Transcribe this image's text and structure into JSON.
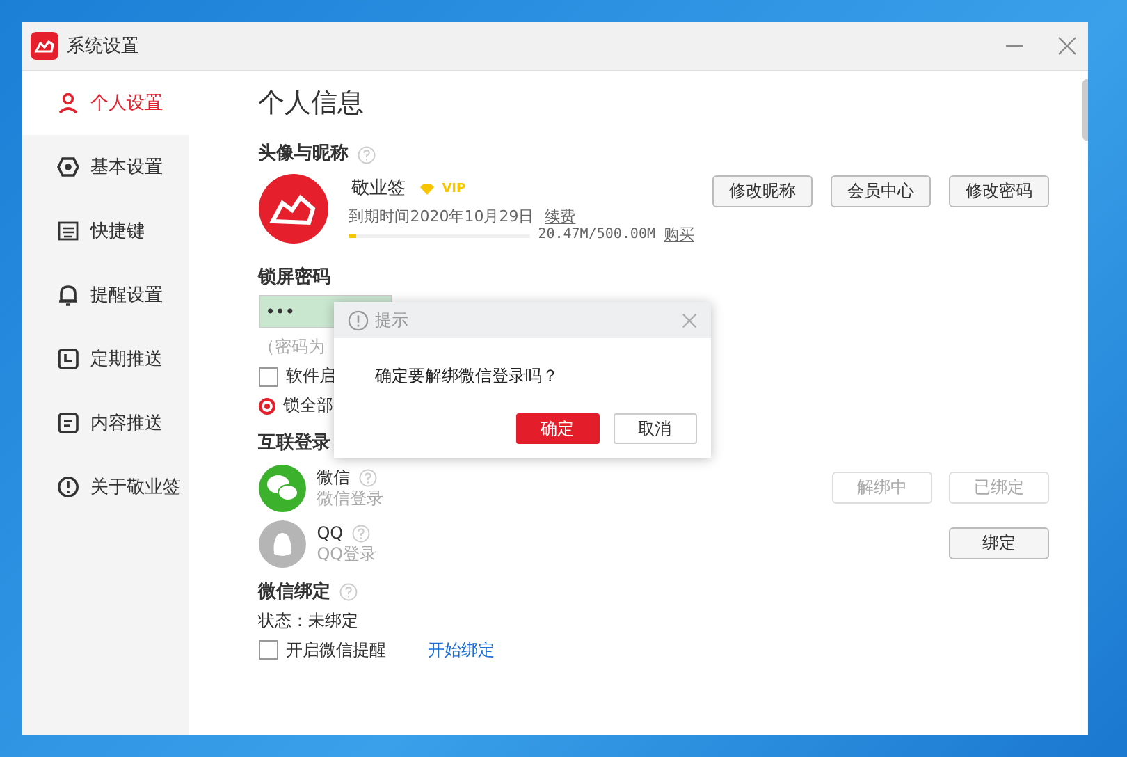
{
  "window": {
    "title": "系统设置"
  },
  "sidebar": {
    "items": [
      {
        "label": "个人设置",
        "selected": true
      },
      {
        "label": "基本设置",
        "selected": false
      },
      {
        "label": "快捷键",
        "selected": false
      },
      {
        "label": "提醒设置",
        "selected": false
      },
      {
        "label": "定期推送",
        "selected": false
      },
      {
        "label": "内容推送",
        "selected": false
      },
      {
        "label": "关于敬业签",
        "selected": false
      }
    ]
  },
  "page_title": "个人信息",
  "profile": {
    "heading": "头像与昵称",
    "name": "敬业签",
    "badge": "VIP",
    "expiry": "到期时间2020年10月29日",
    "renew_link": "续费",
    "storage": {
      "level": 0.04,
      "reading": "20.47M/500.00M",
      "buy_link": "购买"
    },
    "buttons": [
      "修改昵称",
      "会员中心",
      "修改密码"
    ]
  },
  "lock": {
    "heading": "锁屏密码",
    "password": "•••",
    "hint": "（密码为",
    "options": [
      {
        "kind": "checkbox",
        "label": "软件启",
        "checked": false
      },
      {
        "kind": "radio",
        "label": "锁全部",
        "checked": true
      }
    ]
  },
  "linked_login": {
    "heading": "互联登录",
    "accounts": [
      {
        "kind": "wechat",
        "name": "微信",
        "desc": "微信登录",
        "buttons": [
          {
            "label": "解绑中",
            "disabled": true
          },
          {
            "label": "已绑定",
            "disabled": true
          }
        ]
      },
      {
        "kind": "qq",
        "name": "QQ",
        "desc": "QQ登录",
        "buttons": [
          {
            "label": "绑定",
            "disabled": false
          }
        ]
      }
    ]
  },
  "wechat_bind": {
    "heading": "微信绑定",
    "status": "状态：未绑定",
    "reminder": {
      "label": "开启微信提醒",
      "checked": false
    },
    "link": "开始绑定"
  },
  "dialog": {
    "title": "提示",
    "message": "确定要解绑微信登录吗？",
    "buttons": [
      {
        "label": "确定",
        "primary": true
      },
      {
        "label": "取消",
        "primary": false
      }
    ]
  }
}
